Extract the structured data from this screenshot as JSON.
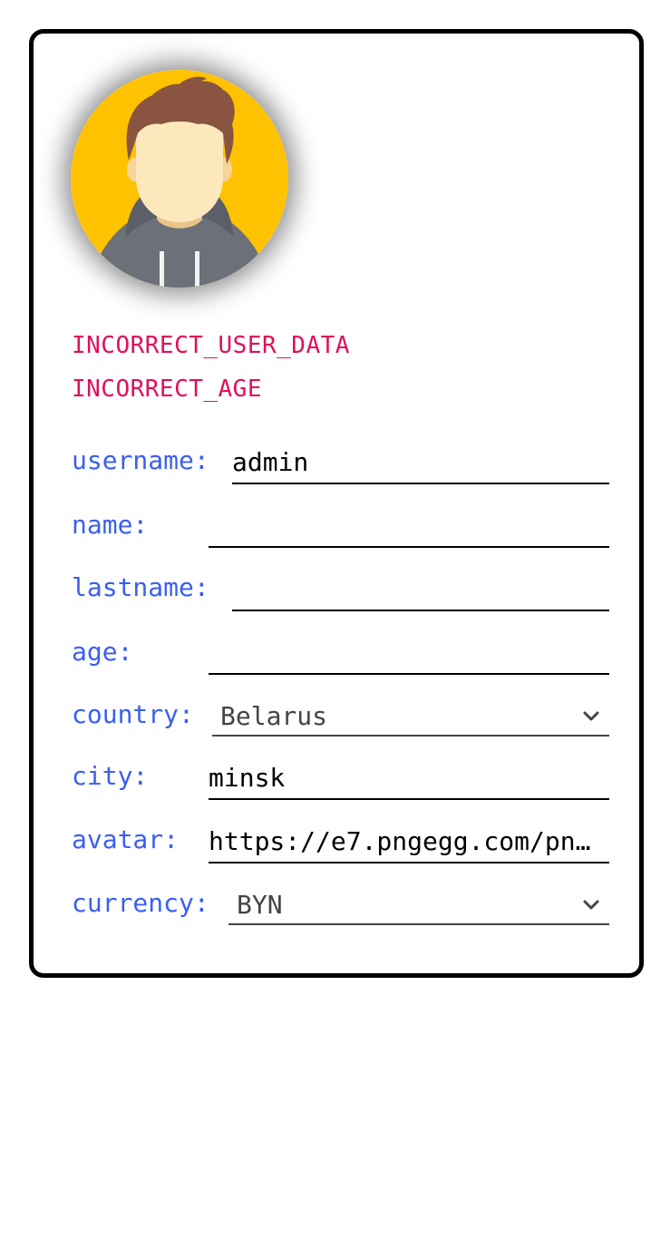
{
  "errors": [
    "INCORRECT_USER_DATA",
    "INCORRECT_AGE"
  ],
  "colors": {
    "error": "#e0105a",
    "label": "#3a5ff0",
    "avatar_bg": "#ffc200"
  },
  "avatar": {
    "icon": "user-avatar-icon"
  },
  "form": {
    "username": {
      "label": "username:",
      "value": "admin"
    },
    "name": {
      "label": "name:",
      "value": ""
    },
    "lastname": {
      "label": "lastname:",
      "value": ""
    },
    "age": {
      "label": "age:",
      "value": ""
    },
    "country": {
      "label": "country:",
      "selected": "Belarus",
      "icon": "chevron-down-icon"
    },
    "city": {
      "label": "city:",
      "value": "minsk"
    },
    "avatar": {
      "label": "avatar:",
      "value": "https://e7.pngegg.com/pn…"
    },
    "currency": {
      "label": "currency:",
      "selected": "BYN",
      "icon": "chevron-down-icon"
    }
  }
}
